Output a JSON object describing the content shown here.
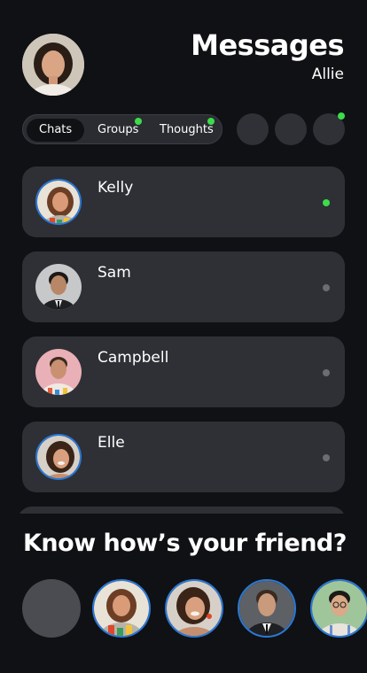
{
  "header": {
    "title": "Messages",
    "username": "Allie"
  },
  "tabs": [
    {
      "label": "Chats",
      "active": true,
      "has_dot": false
    },
    {
      "label": "Groups",
      "active": false,
      "has_dot": true
    },
    {
      "label": "Thoughts",
      "active": false,
      "has_dot": true
    }
  ],
  "chats": [
    {
      "name": "Kelly",
      "online": true
    },
    {
      "name": "Sam",
      "online": false
    },
    {
      "name": "Campbell",
      "online": false
    },
    {
      "name": "Elle",
      "online": false
    }
  ],
  "friends_section": {
    "title": "Know how’s your friend?"
  },
  "colors": {
    "background": "#0f1114",
    "card": "#2e3035",
    "accent_ring": "#2a78d6",
    "online": "#3cdc4a",
    "offline": "#6b6d73"
  }
}
